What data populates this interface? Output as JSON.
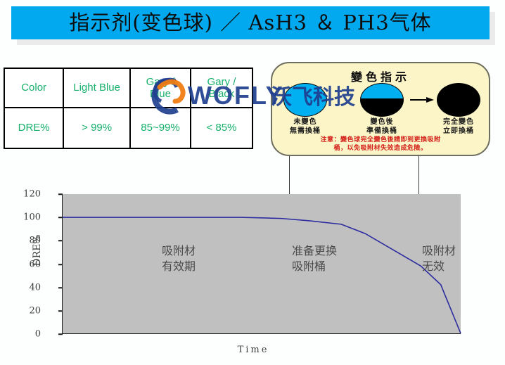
{
  "slide": {
    "title": "指示剂(变色球) ／ AsH3 ＆ PH3气体",
    "accent_color": "#03a9ef",
    "table_text_color": "#16b06b",
    "callout_bg": "#fbf5c8",
    "warning_color": "#d4221a",
    "plot_bg": "#c0c0c0",
    "curve_color": "#2c2ca0"
  },
  "color_table": {
    "rows": [
      {
        "cells": [
          "Color",
          "Light Blue",
          "Gary /\nBlue",
          "Gary /\nBlack"
        ]
      },
      {
        "cells": [
          "DRE%",
          "> 99%",
          "85~99%",
          "< 85%"
        ]
      }
    ]
  },
  "callout": {
    "title": "變色指示",
    "balls": [
      {
        "name": "ball-unchanged",
        "label": "未變色\n無需換桶",
        "fill": "light-blue"
      },
      {
        "name": "ball-half-changed",
        "label": "變色後\n準備換桶",
        "fill": "half-blue-half-black"
      },
      {
        "name": "ball-fully-changed",
        "label": "完全變色\n立即換桶",
        "fill": "black"
      }
    ],
    "warning": "注意：變色球完全變色後請即到更換吸附\n桶，以免吸附材失效造成危險。"
  },
  "chart_data": {
    "type": "line",
    "title": "",
    "xlabel": "Time",
    "ylabel": "DRE%",
    "ylim": [
      0,
      120
    ],
    "yticks": [
      120,
      100,
      80,
      60,
      40,
      20,
      0
    ],
    "grid": false,
    "legend": "none",
    "series": [
      {
        "name": "DRE%",
        "color": "#2c2ca0",
        "points": [
          {
            "x": 0,
            "y": 100
          },
          {
            "x": 45,
            "y": 100
          },
          {
            "x": 55,
            "y": 99
          },
          {
            "x": 62,
            "y": 97
          },
          {
            "x": 70,
            "y": 94
          },
          {
            "x": 76,
            "y": 86
          },
          {
            "x": 84,
            "y": 70
          },
          {
            "x": 90,
            "y": 58
          },
          {
            "x": 95,
            "y": 42
          },
          {
            "x": 100,
            "y": 0
          }
        ]
      }
    ],
    "zones": [
      {
        "name": "effective-period",
        "label": "吸附材\n有效期",
        "x_from": 0,
        "x_to": 58
      },
      {
        "name": "prepare-replace",
        "label": "准备更换\n吸附桶",
        "x_from": 58,
        "x_to": 90
      },
      {
        "name": "ineffective",
        "label": "吸附材\n无效",
        "x_from": 90,
        "x_to": 100
      }
    ],
    "dividers": [
      58,
      90
    ]
  },
  "watermark": {
    "brand": "WOFLY",
    "brand_cn": "沃飞科技",
    "brand_color": "#1f3f8f",
    "mark_accent": "#f07d12"
  }
}
